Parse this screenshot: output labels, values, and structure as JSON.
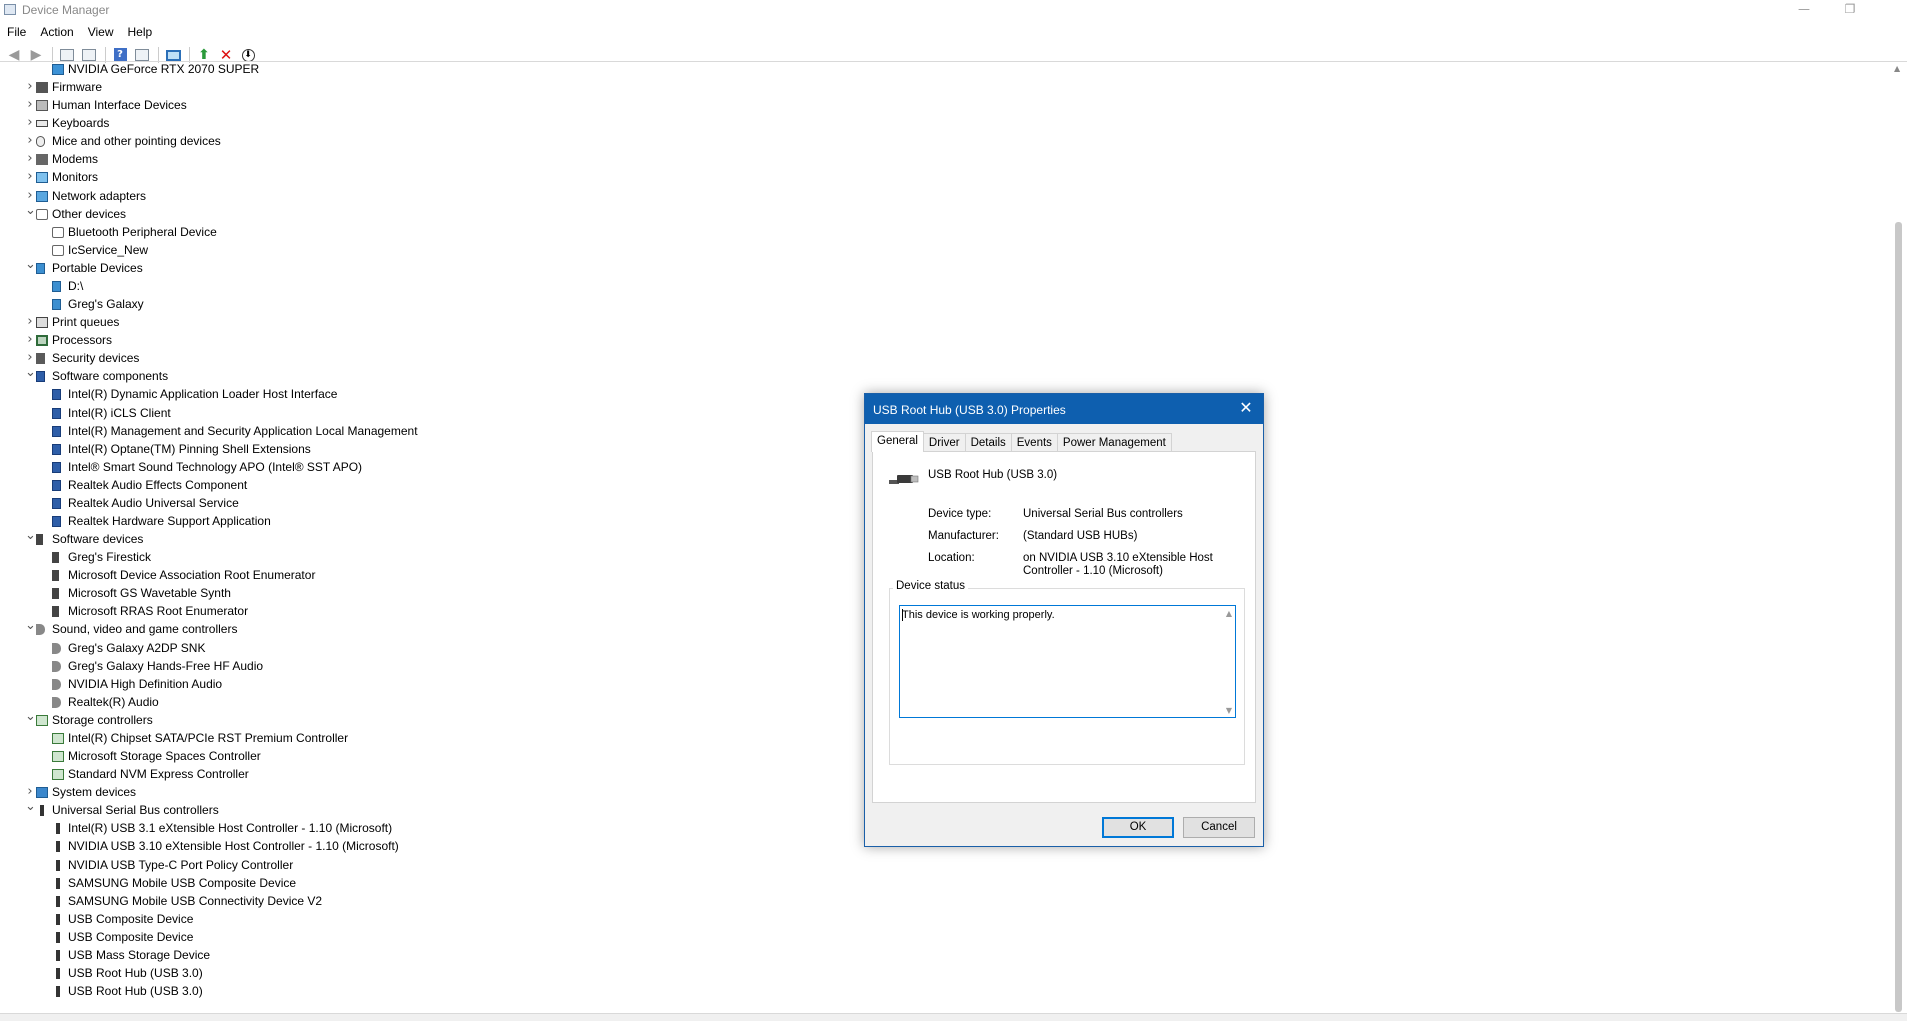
{
  "window": {
    "title": "Device Manager",
    "minimize_glyph": "—",
    "restore_glyph": "❐"
  },
  "menu": [
    "File",
    "Action",
    "View",
    "Help"
  ],
  "toolbar": {
    "icons": [
      "back-arrow-icon",
      "forward-arrow-icon",
      "show-hide-tree-icon",
      "properties-icon",
      "help-icon",
      "view-pane-icon",
      "monitor-icon",
      "update-driver-icon",
      "uninstall-icon",
      "download-icon"
    ]
  },
  "tree": [
    {
      "label": "NVIDIA GeForce RTX 2070 SUPER",
      "level": 1,
      "icon": "gpu"
    },
    {
      "label": "Firmware",
      "level": 0,
      "expanded": false,
      "icon": "fw"
    },
    {
      "label": "Human Interface Devices",
      "level": 0,
      "expanded": false,
      "icon": "hid"
    },
    {
      "label": "Keyboards",
      "level": 0,
      "expanded": false,
      "icon": "kb"
    },
    {
      "label": "Mice and other pointing devices",
      "level": 0,
      "expanded": false,
      "icon": "mouse"
    },
    {
      "label": "Modems",
      "level": 0,
      "expanded": false,
      "icon": "modem"
    },
    {
      "label": "Monitors",
      "level": 0,
      "expanded": false,
      "icon": "monitor"
    },
    {
      "label": "Network adapters",
      "level": 0,
      "expanded": false,
      "icon": "net"
    },
    {
      "label": "Other devices",
      "level": 0,
      "expanded": true,
      "icon": "other"
    },
    {
      "label": "Bluetooth Peripheral Device",
      "level": 1,
      "icon": "other"
    },
    {
      "label": "IcService_New",
      "level": 1,
      "icon": "other"
    },
    {
      "label": "Portable Devices",
      "level": 0,
      "expanded": true,
      "icon": "portable"
    },
    {
      "label": "D:\\",
      "level": 1,
      "icon": "portable"
    },
    {
      "label": "Greg's Galaxy",
      "level": 1,
      "icon": "portable"
    },
    {
      "label": "Print queues",
      "level": 0,
      "expanded": false,
      "icon": "printer"
    },
    {
      "label": "Processors",
      "level": 0,
      "expanded": false,
      "icon": "cpu"
    },
    {
      "label": "Security devices",
      "level": 0,
      "expanded": false,
      "icon": "sec"
    },
    {
      "label": "Software components",
      "level": 0,
      "expanded": true,
      "icon": "sw"
    },
    {
      "label": "Intel(R) Dynamic Application Loader Host Interface",
      "level": 1,
      "icon": "sw"
    },
    {
      "label": "Intel(R) iCLS Client",
      "level": 1,
      "icon": "sw"
    },
    {
      "label": "Intel(R) Management and Security Application Local Management",
      "level": 1,
      "icon": "sw"
    },
    {
      "label": "Intel(R) Optane(TM) Pinning Shell Extensions",
      "level": 1,
      "icon": "sw"
    },
    {
      "label": "Intel® Smart Sound Technology APO (Intel® SST APO)",
      "level": 1,
      "icon": "sw"
    },
    {
      "label": "Realtek Audio Effects Component",
      "level": 1,
      "icon": "sw"
    },
    {
      "label": "Realtek Audio Universal Service",
      "level": 1,
      "icon": "sw"
    },
    {
      "label": "Realtek Hardware Support Application",
      "level": 1,
      "icon": "sw"
    },
    {
      "label": "Software devices",
      "level": 0,
      "expanded": true,
      "icon": "swdev"
    },
    {
      "label": "Greg's Firestick",
      "level": 1,
      "icon": "swdev"
    },
    {
      "label": "Microsoft Device Association Root Enumerator",
      "level": 1,
      "icon": "swdev"
    },
    {
      "label": "Microsoft GS Wavetable Synth",
      "level": 1,
      "icon": "swdev"
    },
    {
      "label": "Microsoft RRAS Root Enumerator",
      "level": 1,
      "icon": "swdev"
    },
    {
      "label": "Sound, video and game controllers",
      "level": 0,
      "expanded": true,
      "icon": "sound"
    },
    {
      "label": "Greg's Galaxy A2DP SNK",
      "level": 1,
      "icon": "sound"
    },
    {
      "label": "Greg's Galaxy Hands-Free HF Audio",
      "level": 1,
      "icon": "sound"
    },
    {
      "label": "NVIDIA High Definition Audio",
      "level": 1,
      "icon": "sound"
    },
    {
      "label": "Realtek(R) Audio",
      "level": 1,
      "icon": "sound"
    },
    {
      "label": "Storage controllers",
      "level": 0,
      "expanded": true,
      "icon": "storage"
    },
    {
      "label": "Intel(R) Chipset SATA/PCIe RST Premium Controller",
      "level": 1,
      "icon": "storage"
    },
    {
      "label": "Microsoft Storage Spaces Controller",
      "level": 1,
      "icon": "storage"
    },
    {
      "label": "Standard NVM Express Controller",
      "level": 1,
      "icon": "storage"
    },
    {
      "label": "System devices",
      "level": 0,
      "expanded": false,
      "icon": "sys"
    },
    {
      "label": "Universal Serial Bus controllers",
      "level": 0,
      "expanded": true,
      "icon": "usb"
    },
    {
      "label": "Intel(R) USB 3.1 eXtensible Host Controller - 1.10 (Microsoft)",
      "level": 1,
      "icon": "usb"
    },
    {
      "label": "NVIDIA USB 3.10 eXtensible Host Controller - 1.10 (Microsoft)",
      "level": 1,
      "icon": "usb"
    },
    {
      "label": "NVIDIA USB Type-C Port Policy Controller",
      "level": 1,
      "icon": "usb"
    },
    {
      "label": "SAMSUNG Mobile USB Composite Device",
      "level": 1,
      "icon": "usb"
    },
    {
      "label": "SAMSUNG Mobile USB Connectivity Device V2",
      "level": 1,
      "icon": "usb"
    },
    {
      "label": "USB Composite Device",
      "level": 1,
      "icon": "usb"
    },
    {
      "label": "USB Composite Device",
      "level": 1,
      "icon": "usb"
    },
    {
      "label": "USB Mass Storage Device",
      "level": 1,
      "icon": "usb"
    },
    {
      "label": "USB Root Hub (USB 3.0)",
      "level": 1,
      "icon": "usb"
    },
    {
      "label": "USB Root Hub (USB 3.0)",
      "level": 1,
      "icon": "usb"
    }
  ],
  "dialog": {
    "title": "USB Root Hub (USB 3.0) Properties",
    "close_glyph": "✕",
    "tabs": [
      "General",
      "Driver",
      "Details",
      "Events",
      "Power Management"
    ],
    "active_tab": "General",
    "device_name": "USB Root Hub (USB 3.0)",
    "device_type_label": "Device type:",
    "device_type_value": "Universal Serial Bus controllers",
    "manufacturer_label": "Manufacturer:",
    "manufacturer_value": "(Standard USB HUBs)",
    "location_label": "Location:",
    "location_value": "on NVIDIA USB 3.10 eXtensible Host Controller - 1.10 (Microsoft)",
    "status_group_label": "Device status",
    "status_text": "This device is working properly.",
    "ok_label": "OK",
    "cancel_label": "Cancel"
  }
}
